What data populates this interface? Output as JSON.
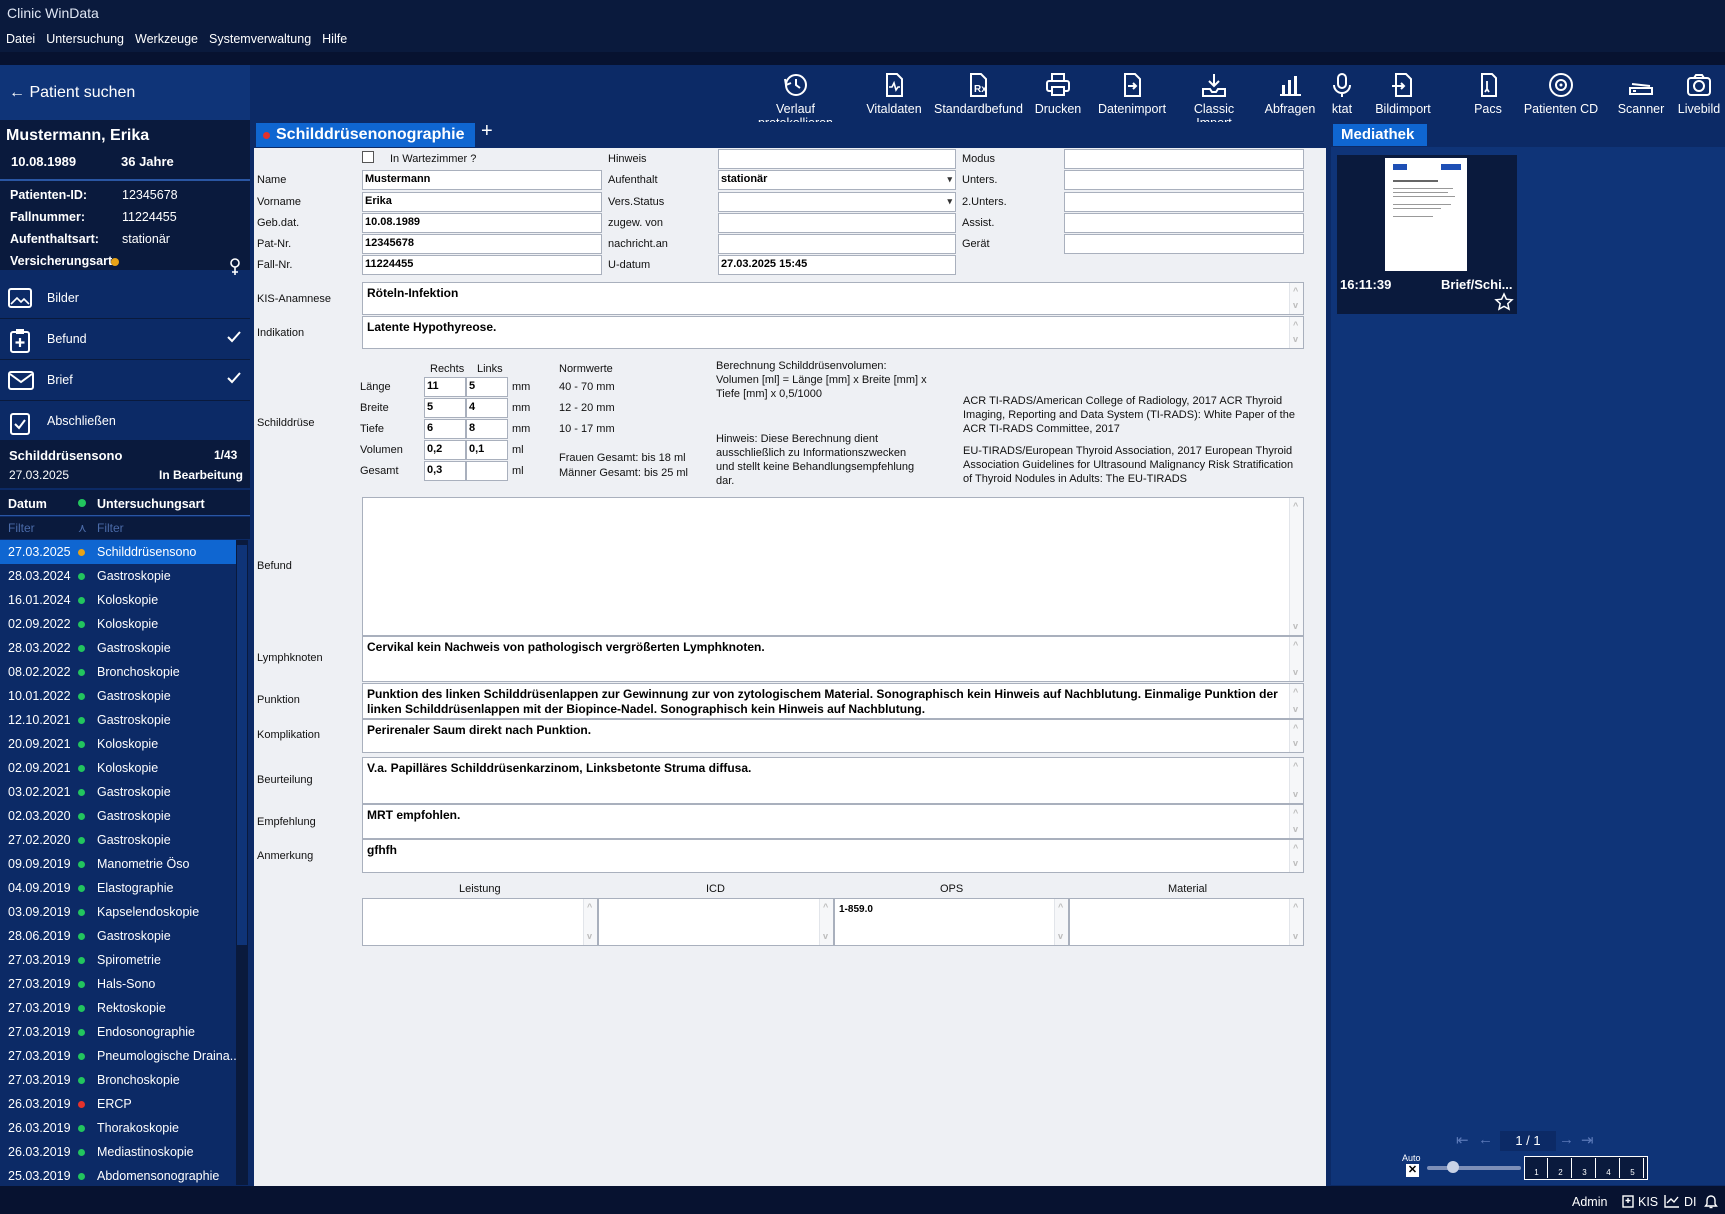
{
  "app": {
    "title": "Clinic WinData"
  },
  "menu": [
    "Datei",
    "Untersuchung",
    "Werkzeuge",
    "Systemverwaltung",
    "Hilfe"
  ],
  "search": {
    "label": "Patient suchen"
  },
  "toolbar": [
    {
      "label": "Verlauf protokollieren",
      "icon": "history-icon"
    },
    {
      "label": "Vitaldaten",
      "icon": "vitals-icon"
    },
    {
      "label": "Standardbefund",
      "icon": "prescription-icon"
    },
    {
      "label": "Drucken",
      "icon": "printer-icon"
    },
    {
      "label": "Datenimport",
      "icon": "file-import-icon"
    },
    {
      "label": "Classic Import",
      "icon": "tray-import-icon"
    },
    {
      "label": "Abfragen",
      "icon": "bar-chart-icon"
    },
    {
      "label": "ktat",
      "icon": "microphone-icon"
    },
    {
      "label": "Bildimport",
      "icon": "image-import-icon"
    },
    {
      "label": "Pacs",
      "icon": "pacs-icon"
    },
    {
      "label": "Patienten CD",
      "icon": "cd-icon"
    },
    {
      "label": "Scanner",
      "icon": "scanner-icon"
    },
    {
      "label": "Livebild",
      "icon": "camera-icon"
    }
  ],
  "patient": {
    "name": "Mustermann, Erika",
    "birth": "10.08.1989",
    "age": "36 Jahre",
    "id_label": "Patienten-ID:",
    "id": "12345678",
    "case_label": "Fallnummer:",
    "case": "11224455",
    "stay_label": "Aufenthaltsart:",
    "stay": "stationär",
    "insurance_label": "Versicherungsart:"
  },
  "nav": [
    {
      "label": "Bilder",
      "checked": false
    },
    {
      "label": "Befund",
      "checked": true
    },
    {
      "label": "Brief",
      "checked": true
    },
    {
      "label": "Abschließen",
      "checked": false
    }
  ],
  "exam": {
    "name": "Schilddrüsensono",
    "count": "1/43",
    "date": "27.03.2025",
    "status": "In Bearbeitung"
  },
  "list": {
    "col_date": "Datum",
    "col_type": "Untersuchungsart",
    "filter": "Filter",
    "rows": [
      {
        "date": "27.03.2025",
        "type": "Schilddrüsensono",
        "status": "#e8a317",
        "selected": true
      },
      {
        "date": "28.03.2024",
        "type": "Gastroskopie",
        "status": "#22c55e"
      },
      {
        "date": "16.01.2024",
        "type": "Koloskopie",
        "status": "#22c55e"
      },
      {
        "date": "02.09.2022",
        "type": "Koloskopie",
        "status": "#22c55e"
      },
      {
        "date": "28.03.2022",
        "type": "Gastroskopie",
        "status": "#22c55e"
      },
      {
        "date": "08.02.2022",
        "type": "Bronchoskopie",
        "status": "#22c55e"
      },
      {
        "date": "10.01.2022",
        "type": "Gastroskopie",
        "status": "#22c55e"
      },
      {
        "date": "12.10.2021",
        "type": "Gastroskopie",
        "status": "#22c55e"
      },
      {
        "date": "20.09.2021",
        "type": "Koloskopie",
        "status": "#22c55e"
      },
      {
        "date": "02.09.2021",
        "type": "Koloskopie",
        "status": "#22c55e"
      },
      {
        "date": "03.02.2021",
        "type": "Gastroskopie",
        "status": "#22c55e"
      },
      {
        "date": "02.03.2020",
        "type": "Gastroskopie",
        "status": "#22c55e"
      },
      {
        "date": "27.02.2020",
        "type": "Gastroskopie",
        "status": "#22c55e"
      },
      {
        "date": "09.09.2019",
        "type": "Manometrie Öso",
        "status": "#22c55e"
      },
      {
        "date": "04.09.2019",
        "type": "Elastographie",
        "status": "#22c55e"
      },
      {
        "date": "03.09.2019",
        "type": "Kapselendoskopie",
        "status": "#22c55e"
      },
      {
        "date": "28.06.2019",
        "type": "Gastroskopie",
        "status": "#22c55e"
      },
      {
        "date": "27.03.2019",
        "type": "Spirometrie",
        "status": "#22c55e"
      },
      {
        "date": "27.03.2019",
        "type": "Hals-Sono",
        "status": "#22c55e"
      },
      {
        "date": "27.03.2019",
        "type": "Rektoskopie",
        "status": "#22c55e"
      },
      {
        "date": "27.03.2019",
        "type": "Endosonographie",
        "status": "#22c55e"
      },
      {
        "date": "27.03.2019",
        "type": "Pneumologische Draina...",
        "status": "#22c55e"
      },
      {
        "date": "27.03.2019",
        "type": "Bronchoskopie",
        "status": "#22c55e"
      },
      {
        "date": "26.03.2019",
        "type": "ERCP",
        "status": "#e5322b"
      },
      {
        "date": "26.03.2019",
        "type": "Thorakoskopie",
        "status": "#22c55e"
      },
      {
        "date": "26.03.2019",
        "type": "Mediastinoskopie",
        "status": "#22c55e"
      },
      {
        "date": "25.03.2019",
        "type": "Abdomensonographie",
        "status": "#22c55e"
      }
    ]
  },
  "tab": {
    "label": "Schilddrüsenonographie"
  },
  "form": {
    "wait_label": "In Wartezimmer ?",
    "name_label": "Name",
    "name": "Mustermann",
    "first_label": "Vorname",
    "first": "Erika",
    "dob_label": "Geb.dat.",
    "dob": "10.08.1989",
    "patnr_label": "Pat-Nr.",
    "patnr": "12345678",
    "case_label": "Fall-Nr.",
    "case": "11224455",
    "hint_label": "Hinweis",
    "hint": "",
    "stay_label": "Aufenthalt",
    "stay": "stationär",
    "ins_label": "Vers.Status",
    "ins": "",
    "assigned_label": "zugew. von",
    "assigned": "",
    "notify_label": "nachricht.an",
    "notify": "",
    "udate_label": "U-datum",
    "udate": "27.03.2025 15:45",
    "mode_label": "Modus",
    "unt_label": "Unters.",
    "unt2_label": "2.Unters.",
    "assist_label": "Assist.",
    "device_label": "Gerät",
    "kis_label": "KIS-Anamnese",
    "kis": "Röteln-Infektion",
    "ind_label": "Indikation",
    "ind": "Latente Hypothyreose.",
    "thyroid_label": "Schilddrüse",
    "right_label": "Rechts",
    "left_label": "Links",
    "norm_label": "Normwerte",
    "measures": [
      {
        "label": "Länge",
        "right": "11",
        "left": "5",
        "unit": "mm",
        "norm": "40 - 70 mm"
      },
      {
        "label": "Breite",
        "right": "5",
        "left": "4",
        "unit": "mm",
        "norm": "12 - 20 mm"
      },
      {
        "label": "Tiefe",
        "right": "6",
        "left": "8",
        "unit": "mm",
        "norm": "10 - 17 mm"
      },
      {
        "label": "Volumen",
        "right": "0,2",
        "left": "0,1",
        "unit": "ml",
        "norm": ""
      },
      {
        "label": "Gesamt",
        "right": "0,3",
        "left": "",
        "unit": "ml",
        "norm": ""
      }
    ],
    "norm_women": "Frauen Gesamt: bis 18 ml",
    "norm_men": "Männer Gesamt: bis 25 ml",
    "calc_title": "Berechnung Schilddrüsenvolumen:",
    "calc_formula": "Volumen [ml] = Länge [mm] x Breite [mm] x Tiefe [mm] x 0,5/1000",
    "calc_note": "Hinweis: Diese Berechnung dient ausschließlich zu Informationszwecken und stellt keine Behandlungsempfehlung dar.",
    "ref1": "ACR TI-RADS/American College of Radiology, 2017 ACR Thyroid Imaging, Reporting and Data System (TI-RADS): White Paper of the ACR TI-RADS Committee, 2017",
    "ref2": "EU-TIRADS/European Thyroid Association, 2017 European Thyroid Association Guidelines for Ultrasound Malignancy Risk Stratification of Thyroid Nodules in Adults: The EU-TIRADS",
    "befund_label": "Befund",
    "befund": "",
    "lymph_label": "Lymphknoten",
    "lymph": "Cervikal kein Nachweis von pathologisch vergrößerten Lymphknoten.",
    "punkt_label": "Punktion",
    "punkt": "Punktion des linken Schilddrüsenlappen zur Gewinnung zur von zytologischem Material. Sonographisch kein Hinweis auf Nachblutung. Einmalige Punktion der linken Schilddrüsenlappen mit der Biopince-Nadel. Sonographisch kein Hinweis auf Nachblutung.",
    "kompl_label": "Komplikation",
    "kompl": "Perirenaler Saum direkt nach Punktion.",
    "beurt_label": "Beurteilung",
    "beurt": "V.a. Papilläres Schilddrüsenkarzinom, Linksbetonte Struma diffusa.",
    "empf_label": "Empfehlung",
    "empf": "MRT empfohlen.",
    "anm_label": "Anmerkung",
    "anm": "gfhfh",
    "leistung_label": "Leistung",
    "icd_label": "ICD",
    "ops_label": "OPS",
    "material_label": "Material",
    "ops": "1-859.0"
  },
  "media": {
    "tab": "Mediathek",
    "time": "16:11:39",
    "title": "Brief/Schi...",
    "page": "1 / 1",
    "auto": "Auto",
    "layouts": [
      "1",
      "2",
      "3",
      "4",
      "5"
    ]
  },
  "status": {
    "user": "Admin",
    "kis": "KIS",
    "di": "DI"
  }
}
